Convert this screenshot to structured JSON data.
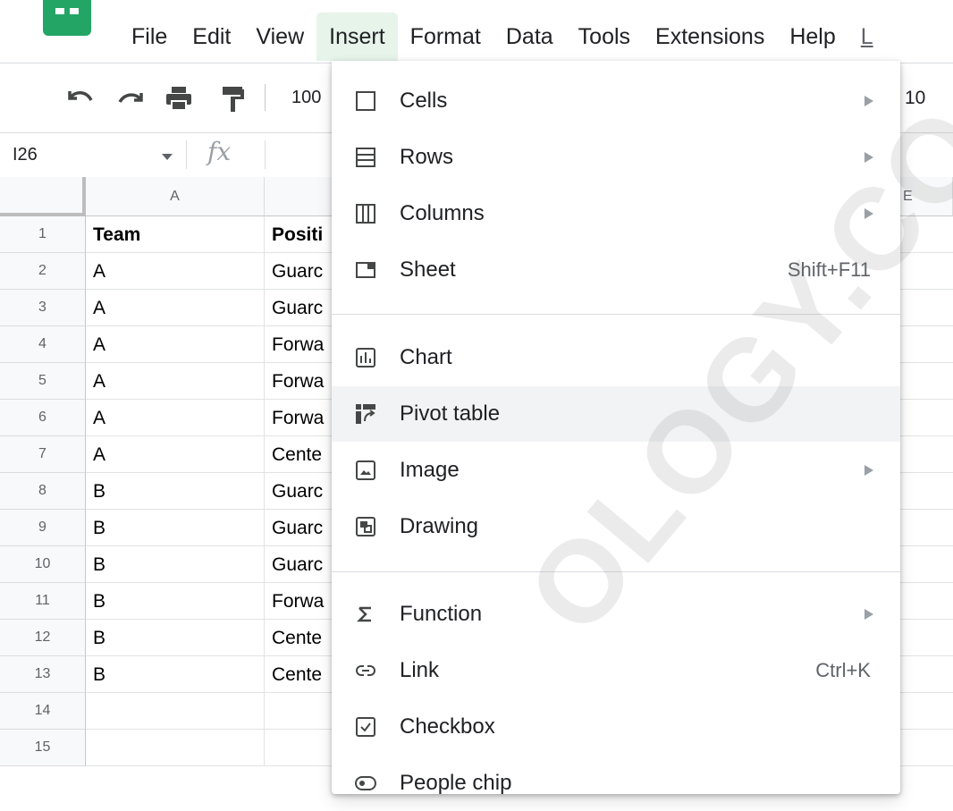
{
  "menu": {
    "items": [
      "File",
      "Edit",
      "View",
      "Insert",
      "Format",
      "Data",
      "Tools",
      "Extensions",
      "Help",
      "L"
    ],
    "active": "Insert"
  },
  "toolbar": {
    "zoom": "100",
    "font_size": "10"
  },
  "formula_bar": {
    "cell_ref": "I26",
    "fx": "fx"
  },
  "grid": {
    "columns": [
      "A",
      "",
      "",
      "",
      "E"
    ],
    "rows": [
      {
        "num": "1",
        "a": "Team",
        "b": "Positi"
      },
      {
        "num": "2",
        "a": "A",
        "b": "Guarc"
      },
      {
        "num": "3",
        "a": "A",
        "b": "Guarc"
      },
      {
        "num": "4",
        "a": "A",
        "b": "Forwa"
      },
      {
        "num": "5",
        "a": "A",
        "b": "Forwa"
      },
      {
        "num": "6",
        "a": "A",
        "b": "Forwa"
      },
      {
        "num": "7",
        "a": "A",
        "b": "Cente"
      },
      {
        "num": "8",
        "a": "B",
        "b": "Guarc"
      },
      {
        "num": "9",
        "a": "B",
        "b": "Guarc"
      },
      {
        "num": "10",
        "a": "B",
        "b": "Guarc"
      },
      {
        "num": "11",
        "a": "B",
        "b": "Forwa"
      },
      {
        "num": "12",
        "a": "B",
        "b": "Cente"
      },
      {
        "num": "13",
        "a": "B",
        "b": "Cente"
      },
      {
        "num": "14",
        "a": "",
        "b": ""
      },
      {
        "num": "15",
        "a": "",
        "b": ""
      }
    ]
  },
  "insert_menu": {
    "items": [
      {
        "label": "Cells",
        "icon": "cells-icon",
        "submenu": true
      },
      {
        "label": "Rows",
        "icon": "rows-icon",
        "submenu": true
      },
      {
        "label": "Columns",
        "icon": "columns-icon",
        "submenu": true
      },
      {
        "label": "Sheet",
        "icon": "sheet-icon",
        "shortcut": "Shift+F11"
      },
      {
        "label": "Chart",
        "icon": "chart-icon"
      },
      {
        "label": "Pivot table",
        "icon": "pivot-table-icon",
        "highlighted": true
      },
      {
        "label": "Image",
        "icon": "image-icon",
        "submenu": true
      },
      {
        "label": "Drawing",
        "icon": "drawing-icon"
      },
      {
        "label": "Function",
        "icon": "sigma-icon",
        "submenu": true
      },
      {
        "label": "Link",
        "icon": "link-icon",
        "shortcut": "Ctrl+K"
      },
      {
        "label": "Checkbox",
        "icon": "checkbox-icon"
      },
      {
        "label": "People chip",
        "icon": "people-chip-icon"
      }
    ]
  },
  "watermark": "OLOGY.CO",
  "colors": {
    "logo": "#23a566",
    "active_menu_bg": "#e6f4ea",
    "highlight_bg": "#f1f3f4"
  }
}
